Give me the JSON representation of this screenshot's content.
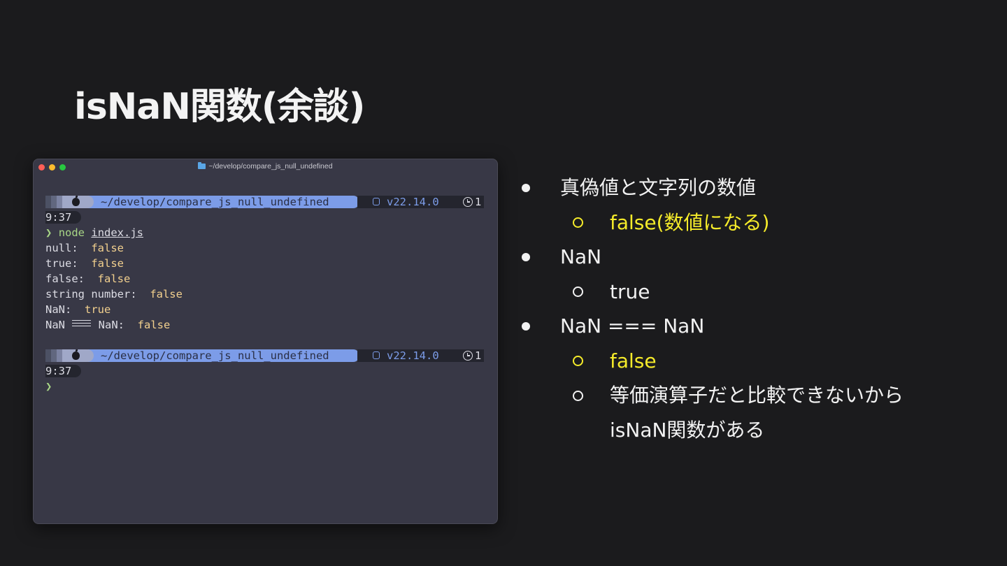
{
  "slide": {
    "title": "isNaN関数(余談)"
  },
  "terminal": {
    "window_title": "~/develop/compare_js_null_undefined",
    "prompt": {
      "path": "~/develop/compare_js_null_undefined",
      "node_version": "v22.14.0",
      "clock_clipped": "1",
      "time_wrapped": "9:37"
    },
    "arrow": "❯",
    "command": "node",
    "command_arg": "index.js",
    "output": [
      {
        "label": "null:  ",
        "value": "false"
      },
      {
        "label": "true:  ",
        "value": "false"
      },
      {
        "label": "false:  ",
        "value": "false"
      },
      {
        "label": "string number:  ",
        "value": "false"
      },
      {
        "label": "NaN:  ",
        "value": "true"
      }
    ],
    "last_line": {
      "left": "NaN ",
      "right": " NaN:  ",
      "value": "false"
    }
  },
  "bullets": {
    "item1": "真偽値と文字列の数値",
    "item1_sub": "false(数値になる)",
    "item2": "NaN",
    "item2_sub": "true",
    "item3": "NaN === NaN",
    "item3_sub1": "false",
    "item3_sub2_line1": "等価演算子だと比較できないから",
    "item3_sub2_line2": "isNaN関数がある"
  },
  "colors": {
    "background": "#1b1b1d",
    "terminal_bg": "#383846",
    "highlight_yellow": "#f5eb2a",
    "path_segment": "#7c9ce8",
    "terminal_value": "#f2d08e",
    "command_green": "#a8d686"
  }
}
